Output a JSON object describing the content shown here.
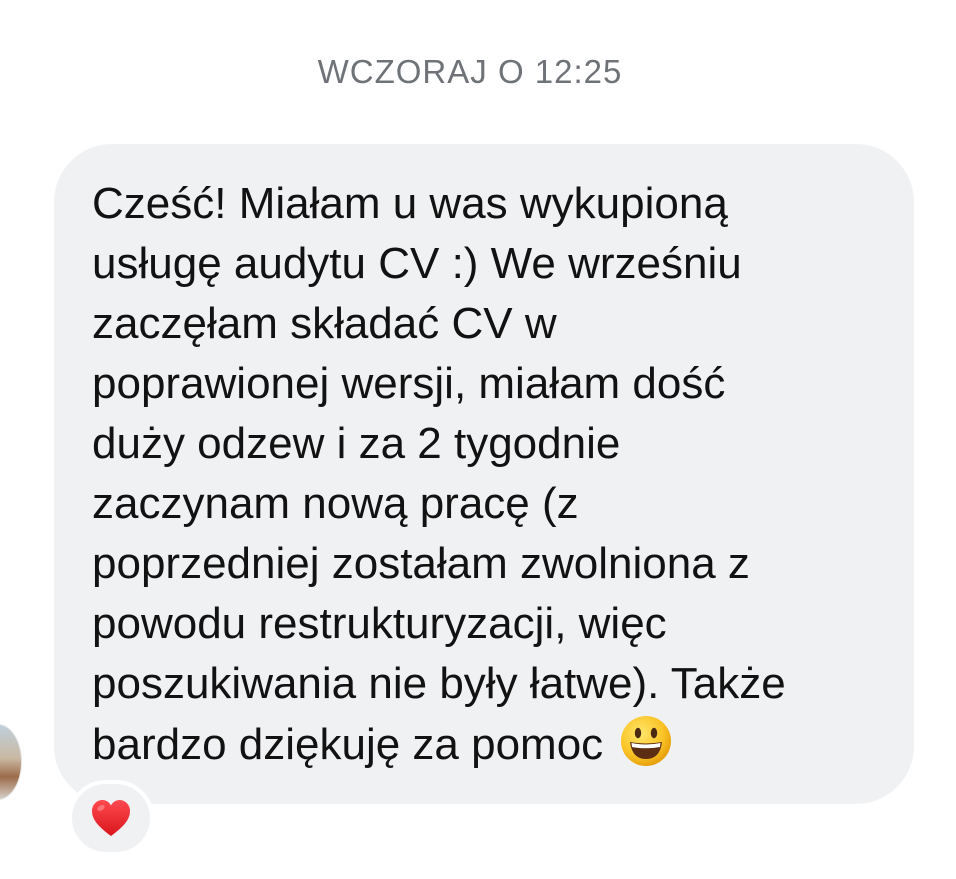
{
  "thread": {
    "timestamp": "WCZORAJ O 12:25"
  },
  "message": {
    "text": "Cześć! Miałam u was wykupioną\nusługę audytu CV :) We wrześniu\nzaczęłam składać CV w\npoprawionej wersji, miałam dość\nduży odzew i za 2 tygodnie\nzaczynam nową pracę (z\npoprzedniej zostałam zwolniona z\npowodu restrukturyzacji, więc\nposzukiwania nie były łatwe). Także\nbardzo dziękuję za pomoc",
    "trailing_emoji": "smiley-face-icon",
    "bubble_color": "#f0f1f3",
    "text_color": "#121212"
  },
  "reaction": {
    "icon": "red-heart-icon",
    "color": "#e3242b"
  },
  "sender": {
    "avatar": "avatar-photo"
  }
}
